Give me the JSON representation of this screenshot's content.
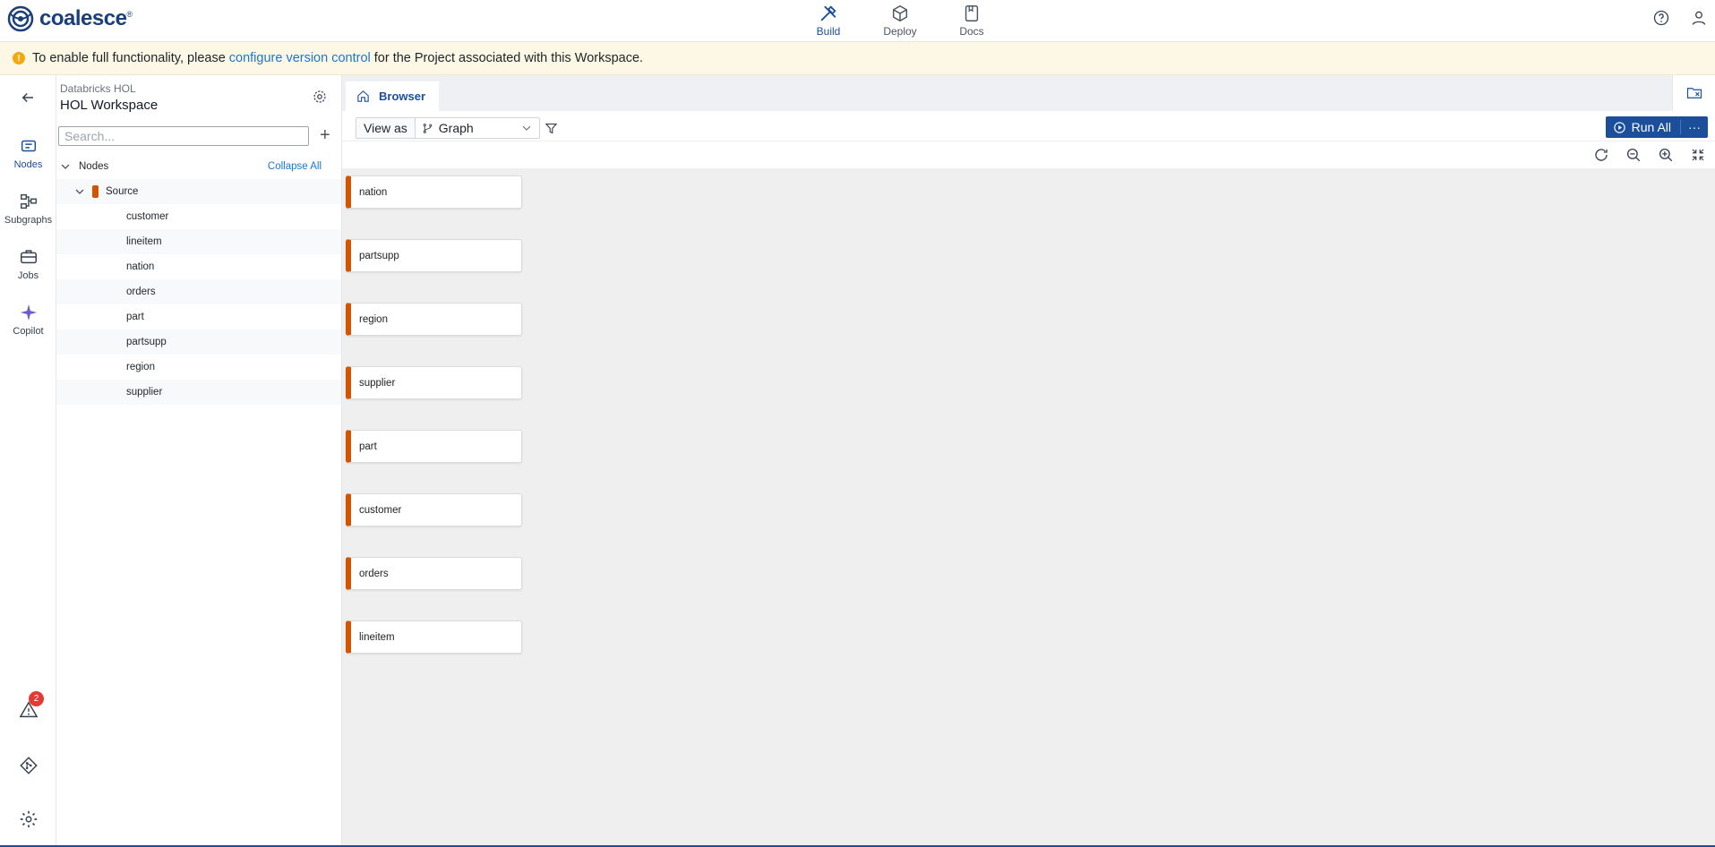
{
  "app": {
    "logo_text": "coalesce",
    "logo_mark": "®"
  },
  "topnav": [
    {
      "label": "Build",
      "icon": "build-icon",
      "active": true
    },
    {
      "label": "Deploy",
      "icon": "deploy-icon",
      "active": false
    },
    {
      "label": "Docs",
      "icon": "docs-icon",
      "active": false
    }
  ],
  "banner": {
    "prefix": "To enable full functionality, please",
    "link": "configure version control",
    "suffix": "for the Project associated with this Workspace."
  },
  "rail": {
    "items": [
      {
        "label": "Nodes",
        "icon": "nodes-icon",
        "active": true
      },
      {
        "label": "Subgraphs",
        "icon": "subgraphs-icon"
      },
      {
        "label": "Jobs",
        "icon": "jobs-icon"
      },
      {
        "label": "Copilot",
        "icon": "copilot-icon"
      }
    ],
    "problems_count": "2"
  },
  "sidebar": {
    "project": "Databricks HOL",
    "workspace": "HOL Workspace",
    "search_placeholder": "Search...",
    "nodes_label": "Nodes",
    "collapse_all": "Collapse All",
    "group": "Source",
    "children": [
      "customer",
      "lineitem",
      "nation",
      "orders",
      "part",
      "partsupp",
      "region",
      "supplier"
    ]
  },
  "main": {
    "tab_label": "Browser",
    "view_as": "View as",
    "view_mode": "Graph",
    "run_all": "Run All",
    "more": "···"
  },
  "graph": {
    "nodes": [
      "nation",
      "partsupp",
      "region",
      "supplier",
      "part",
      "customer",
      "orders",
      "lineitem"
    ],
    "accent": "#d35400"
  },
  "colors": {
    "brand": "#1b4f9c",
    "link": "#1976d2",
    "warning": "#f3a712",
    "badge": "#e53935"
  }
}
